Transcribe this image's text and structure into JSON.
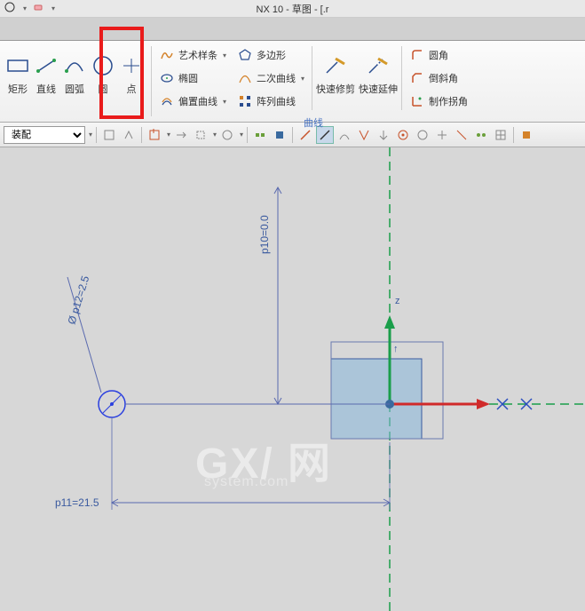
{
  "window": {
    "title": "NX 10 - 草图 - [.r"
  },
  "ribbon": {
    "tools": [
      {
        "label": "矩形"
      },
      {
        "label": "直线"
      },
      {
        "label": "圆弧"
      },
      {
        "label": "圆"
      },
      {
        "label": "点"
      }
    ],
    "smallLeft": [
      {
        "label": "艺术样条"
      },
      {
        "label": "椭圆"
      },
      {
        "label": "偏置曲线"
      }
    ],
    "smallMid": [
      {
        "label": "多边形"
      },
      {
        "label": "二次曲线"
      },
      {
        "label": "阵列曲线"
      }
    ],
    "editTools": [
      {
        "label": "快速修剪"
      },
      {
        "label": "快速延伸"
      }
    ],
    "corner": [
      {
        "label": "圆角"
      },
      {
        "label": "倒斜角"
      },
      {
        "label": "制作拐角"
      }
    ],
    "groupLabel": "曲线"
  },
  "secondary": {
    "assembly": "装配"
  },
  "sketch": {
    "dimP10": "p10=0.0",
    "dimP11": "p11=21.5",
    "dimP12": "p12=2.5",
    "phi": "Ø"
  },
  "watermark": {
    "main": "GX/ 网",
    "sub": "system.com"
  }
}
